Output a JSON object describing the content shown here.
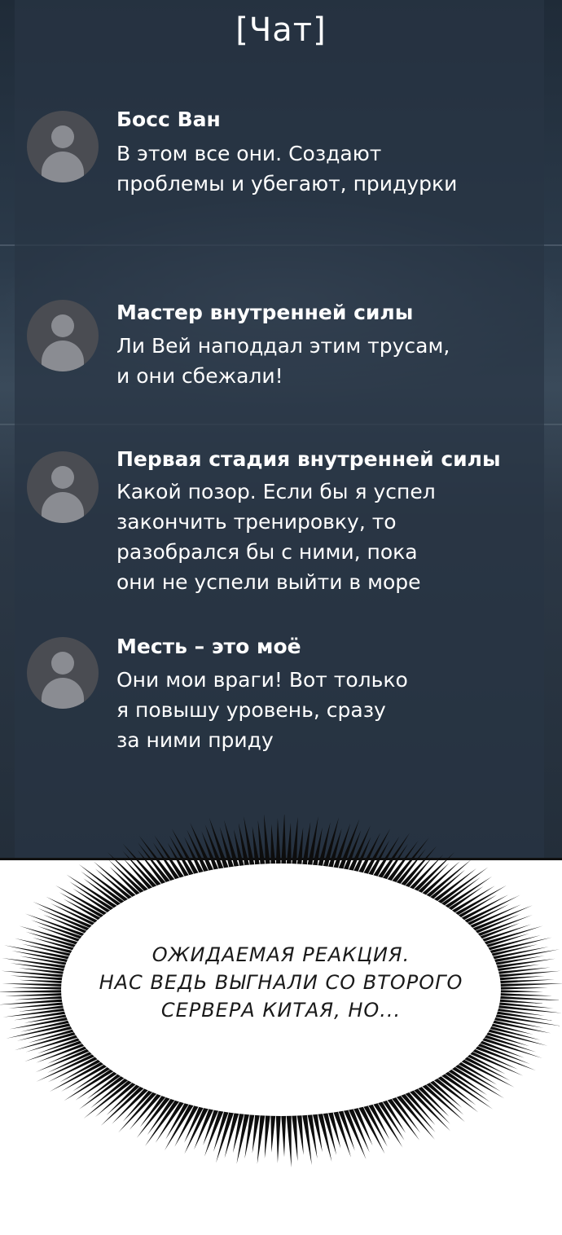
{
  "chat": {
    "title": "[Чат]",
    "messages": [
      {
        "name": "Босс Ван",
        "lines": [
          "В этом все они. Создают",
          "проблемы и убегают, придурки"
        ]
      },
      {
        "name": "Мастер внутренней силы",
        "lines": [
          "Ли Вей наподдал этим трусам,",
          "и они сбежали!"
        ]
      },
      {
        "name": "Первая стадия внутренней силы",
        "lines": [
          "Какой позор. Если бы я успел",
          "закончить тренировку, то",
          "разобрался бы с ними, пока",
          "они не успели выйти в море"
        ]
      },
      {
        "name": "Месть – это моё",
        "lines": [
          "Они мои враги! Вот только",
          "я повышу уровень, сразу",
          "за ними приду"
        ]
      }
    ]
  },
  "bubble": {
    "lines": [
      "ОЖИДАЕМАЯ РЕАКЦИЯ.",
      "НАС ВЕДЬ ВЫГНАЛИ СО ВТОРОГО",
      "СЕРВЕРА КИТАЯ, НО..."
    ]
  }
}
